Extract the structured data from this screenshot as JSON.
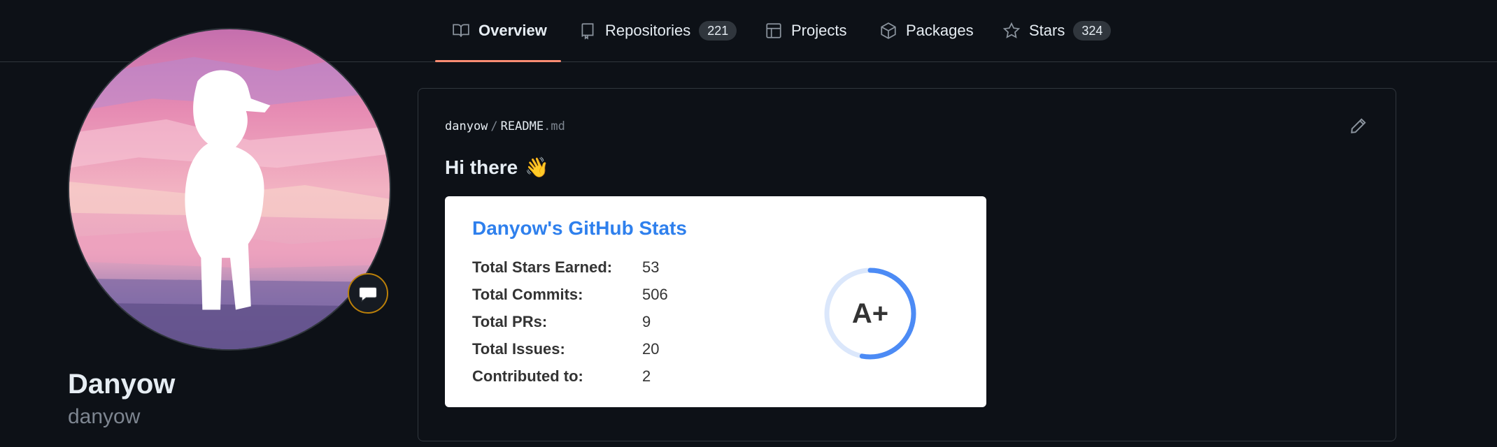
{
  "nav": {
    "tabs": [
      {
        "label": "Overview",
        "icon": "book-icon",
        "active": true
      },
      {
        "label": "Repositories",
        "icon": "repo-icon",
        "count": "221"
      },
      {
        "label": "Projects",
        "icon": "table-icon"
      },
      {
        "label": "Packages",
        "icon": "package-icon"
      },
      {
        "label": "Stars",
        "icon": "star-icon",
        "count": "324"
      }
    ]
  },
  "profile": {
    "name": "Danyow",
    "login": "danyow",
    "status_icon": "speech-bubble-icon"
  },
  "readme": {
    "owner": "danyow",
    "separator": "/",
    "file_base": "README",
    "file_ext": ".md",
    "heading": "Hi there",
    "heading_emoji": "👋",
    "edit_icon": "pencil-icon"
  },
  "stats": {
    "title": "Danyow's GitHub Stats",
    "rows": [
      {
        "label": "Total Stars Earned:",
        "value": "53"
      },
      {
        "label": "Total Commits:",
        "value": "506"
      },
      {
        "label": "Total PRs:",
        "value": "9"
      },
      {
        "label": "Total Issues:",
        "value": "20"
      },
      {
        "label": "Contributed to:",
        "value": "2"
      }
    ],
    "rank": "A+",
    "rank_progress": 0.53
  },
  "colors": {
    "background": "#0d1117",
    "border": "#30363d",
    "active_tab_underline": "#fd8c73",
    "stats_title": "#2f80ed",
    "rank_ring": "#4c8bf5",
    "rank_ring_track": "#dbe7fb"
  }
}
